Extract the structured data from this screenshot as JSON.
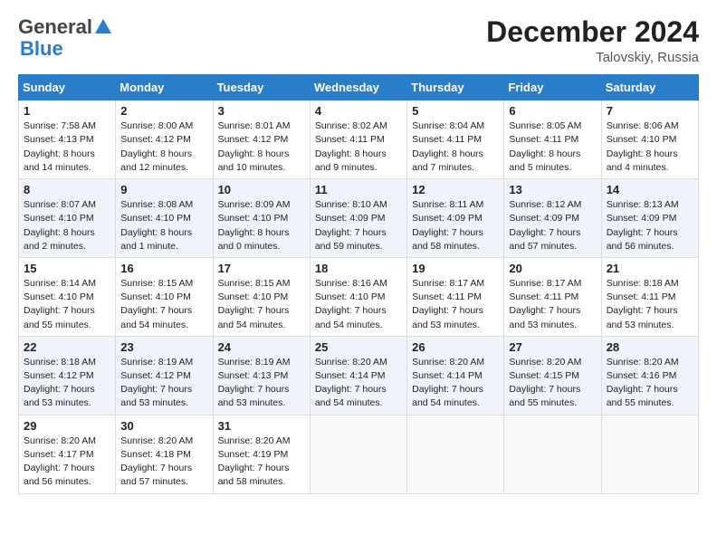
{
  "logo": {
    "general": "General",
    "blue": "Blue"
  },
  "title": "December 2024",
  "subtitle": "Talovskiy, Russia",
  "days_header": [
    "Sunday",
    "Monday",
    "Tuesday",
    "Wednesday",
    "Thursday",
    "Friday",
    "Saturday"
  ],
  "weeks": [
    [
      {
        "day": "1",
        "sunrise": "7:58 AM",
        "sunset": "4:13 PM",
        "daylight": "8 hours and 14 minutes."
      },
      {
        "day": "2",
        "sunrise": "8:00 AM",
        "sunset": "4:12 PM",
        "daylight": "8 hours and 12 minutes."
      },
      {
        "day": "3",
        "sunrise": "8:01 AM",
        "sunset": "4:12 PM",
        "daylight": "8 hours and 10 minutes."
      },
      {
        "day": "4",
        "sunrise": "8:02 AM",
        "sunset": "4:11 PM",
        "daylight": "8 hours and 9 minutes."
      },
      {
        "day": "5",
        "sunrise": "8:04 AM",
        "sunset": "4:11 PM",
        "daylight": "8 hours and 7 minutes."
      },
      {
        "day": "6",
        "sunrise": "8:05 AM",
        "sunset": "4:11 PM",
        "daylight": "8 hours and 5 minutes."
      },
      {
        "day": "7",
        "sunrise": "8:06 AM",
        "sunset": "4:10 PM",
        "daylight": "8 hours and 4 minutes."
      }
    ],
    [
      {
        "day": "8",
        "sunrise": "8:07 AM",
        "sunset": "4:10 PM",
        "daylight": "8 hours and 2 minutes."
      },
      {
        "day": "9",
        "sunrise": "8:08 AM",
        "sunset": "4:10 PM",
        "daylight": "8 hours and 1 minute."
      },
      {
        "day": "10",
        "sunrise": "8:09 AM",
        "sunset": "4:10 PM",
        "daylight": "8 hours and 0 minutes."
      },
      {
        "day": "11",
        "sunrise": "8:10 AM",
        "sunset": "4:09 PM",
        "daylight": "7 hours and 59 minutes."
      },
      {
        "day": "12",
        "sunrise": "8:11 AM",
        "sunset": "4:09 PM",
        "daylight": "7 hours and 58 minutes."
      },
      {
        "day": "13",
        "sunrise": "8:12 AM",
        "sunset": "4:09 PM",
        "daylight": "7 hours and 57 minutes."
      },
      {
        "day": "14",
        "sunrise": "8:13 AM",
        "sunset": "4:09 PM",
        "daylight": "7 hours and 56 minutes."
      }
    ],
    [
      {
        "day": "15",
        "sunrise": "8:14 AM",
        "sunset": "4:10 PM",
        "daylight": "7 hours and 55 minutes."
      },
      {
        "day": "16",
        "sunrise": "8:15 AM",
        "sunset": "4:10 PM",
        "daylight": "7 hours and 54 minutes."
      },
      {
        "day": "17",
        "sunrise": "8:15 AM",
        "sunset": "4:10 PM",
        "daylight": "7 hours and 54 minutes."
      },
      {
        "day": "18",
        "sunrise": "8:16 AM",
        "sunset": "4:10 PM",
        "daylight": "7 hours and 54 minutes."
      },
      {
        "day": "19",
        "sunrise": "8:17 AM",
        "sunset": "4:11 PM",
        "daylight": "7 hours and 53 minutes."
      },
      {
        "day": "20",
        "sunrise": "8:17 AM",
        "sunset": "4:11 PM",
        "daylight": "7 hours and 53 minutes."
      },
      {
        "day": "21",
        "sunrise": "8:18 AM",
        "sunset": "4:11 PM",
        "daylight": "7 hours and 53 minutes."
      }
    ],
    [
      {
        "day": "22",
        "sunrise": "8:18 AM",
        "sunset": "4:12 PM",
        "daylight": "7 hours and 53 minutes."
      },
      {
        "day": "23",
        "sunrise": "8:19 AM",
        "sunset": "4:12 PM",
        "daylight": "7 hours and 53 minutes."
      },
      {
        "day": "24",
        "sunrise": "8:19 AM",
        "sunset": "4:13 PM",
        "daylight": "7 hours and 53 minutes."
      },
      {
        "day": "25",
        "sunrise": "8:20 AM",
        "sunset": "4:14 PM",
        "daylight": "7 hours and 54 minutes."
      },
      {
        "day": "26",
        "sunrise": "8:20 AM",
        "sunset": "4:14 PM",
        "daylight": "7 hours and 54 minutes."
      },
      {
        "day": "27",
        "sunrise": "8:20 AM",
        "sunset": "4:15 PM",
        "daylight": "7 hours and 55 minutes."
      },
      {
        "day": "28",
        "sunrise": "8:20 AM",
        "sunset": "4:16 PM",
        "daylight": "7 hours and 55 minutes."
      }
    ],
    [
      {
        "day": "29",
        "sunrise": "8:20 AM",
        "sunset": "4:17 PM",
        "daylight": "7 hours and 56 minutes."
      },
      {
        "day": "30",
        "sunrise": "8:20 AM",
        "sunset": "4:18 PM",
        "daylight": "7 hours and 57 minutes."
      },
      {
        "day": "31",
        "sunrise": "8:20 AM",
        "sunset": "4:19 PM",
        "daylight": "7 hours and 58 minutes."
      },
      null,
      null,
      null,
      null
    ]
  ]
}
